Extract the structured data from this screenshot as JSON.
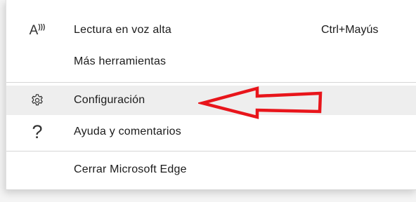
{
  "menu": {
    "items": [
      {
        "label": "Lectura en voz alta",
        "shortcut": "Ctrl+Mayús",
        "icon": "read-aloud-icon",
        "icon_text": "A"
      },
      {
        "label": "Más herramientas"
      },
      {
        "label": "Configuración",
        "icon": "gear-icon"
      },
      {
        "label": "Ayuda y comentarios",
        "icon": "help-icon",
        "icon_text": "?"
      },
      {
        "label": "Cerrar Microsoft Edge"
      }
    ]
  },
  "annotation": {
    "arrow_color": "#e8151b",
    "arrow_icon": "left-arrow-icon"
  },
  "colors": {
    "hover_bg": "#eeeeee",
    "menu_bg": "#ffffff",
    "text": "#1b1b1b"
  }
}
